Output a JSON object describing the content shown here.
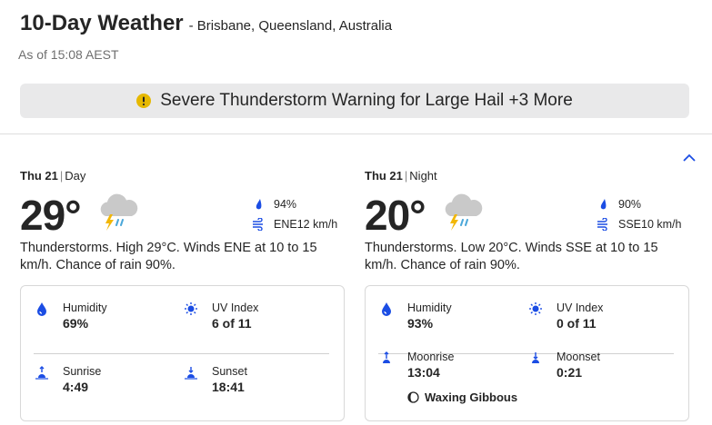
{
  "header": {
    "title": "10-Day Weather",
    "location": "- Brisbane, Queensland, Australia",
    "as_of": "As of 15:08 AEST"
  },
  "alert": {
    "text": "Severe Thunderstorm Warning for Large Hail +3 More",
    "icon": "warning-icon",
    "accent": "#d4a017"
  },
  "day": {
    "date": "Thu 21",
    "part": "Day",
    "temp": "29°",
    "condition_icon": "thunderstorm-icon",
    "precip": "94%",
    "wind": "ENE12 km/h",
    "phrase": "Thunderstorms. High 29°C. Winds ENE at 10 to 15 km/h. Chance of rain 90%.",
    "humidity_label": "Humidity",
    "humidity": "69%",
    "uv_label": "UV Index",
    "uv": "6 of 11",
    "sunrise_label": "Sunrise",
    "sunrise": "4:49",
    "sunset_label": "Sunset",
    "sunset": "18:41"
  },
  "night": {
    "date": "Thu 21",
    "part": "Night",
    "temp": "20°",
    "condition_icon": "thunderstorm-icon",
    "precip": "90%",
    "wind": "SSE10 km/h",
    "phrase": "Thunderstorms. Low 20°C. Winds SSE at 10 to 15 km/h. Chance of rain 90%.",
    "humidity_label": "Humidity",
    "humidity": "93%",
    "uv_label": "UV Index",
    "uv": "0 of 11",
    "moonrise_label": "Moonrise",
    "moonrise": "13:04",
    "moonset_label": "Moonset",
    "moonset": "0:21",
    "moon_phase": "Waxing Gibbous"
  },
  "colors": {
    "icon_blue": "#1b4de4",
    "bolt_yellow": "#f2b705",
    "rain_blue": "#4aa7d9"
  }
}
